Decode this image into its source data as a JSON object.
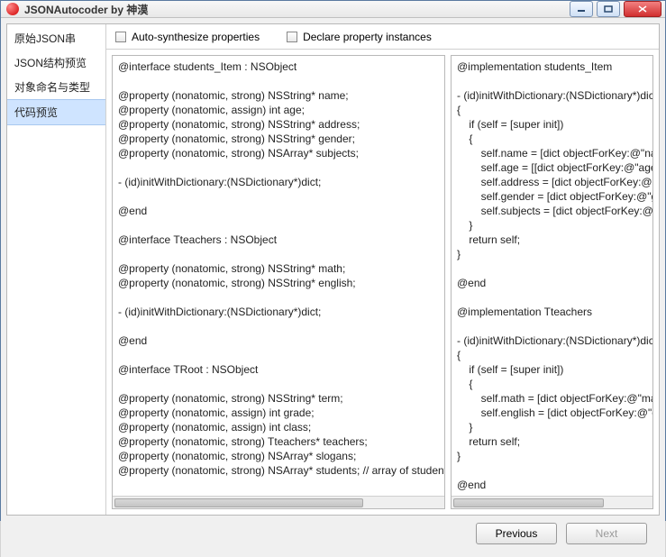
{
  "window": {
    "title": "JSONAutocoder by 神漠"
  },
  "sidebar": {
    "items": [
      {
        "label": "原始JSON串",
        "selected": false
      },
      {
        "label": "JSON结构预览",
        "selected": false
      },
      {
        "label": "对象命名与类型",
        "selected": false
      },
      {
        "label": "代码预览",
        "selected": true
      }
    ]
  },
  "options": {
    "auto_synth": "Auto-synthesize properties",
    "declare_inst": "Declare property instances"
  },
  "code_left": "@interface students_Item : NSObject\n\n@property (nonatomic, strong) NSString* name;\n@property (nonatomic, assign) int age;\n@property (nonatomic, strong) NSString* address;\n@property (nonatomic, strong) NSString* gender;\n@property (nonatomic, strong) NSArray* subjects;\n\n- (id)initWithDictionary:(NSDictionary*)dict;\n\n@end\n\n@interface Tteachers : NSObject\n\n@property (nonatomic, strong) NSString* math;\n@property (nonatomic, strong) NSString* english;\n\n- (id)initWithDictionary:(NSDictionary*)dict;\n\n@end\n\n@interface TRoot : NSObject\n\n@property (nonatomic, strong) NSString* term;\n@property (nonatomic, assign) int grade;\n@property (nonatomic, assign) int class;\n@property (nonatomic, strong) Tteachers* teachers;\n@property (nonatomic, strong) NSArray* slogans;\n@property (nonatomic, strong) NSArray* students; // array of students_Item",
  "code_right": "@implementation students_Item\n\n- (id)initWithDictionary:(NSDictionary*)dict\n{\n    if (self = [super init])\n    {\n        self.name = [dict objectForKey:@\"name\"];\n        self.age = [[dict objectForKey:@\"age\"] intValue];\n        self.address = [dict objectForKey:@\"address\"];\n        self.gender = [dict objectForKey:@\"gender\"];\n        self.subjects = [dict objectForKey:@\"subjects\"];\n    }\n    return self;\n}\n\n@end\n\n@implementation Tteachers\n\n- (id)initWithDictionary:(NSDictionary*)dict\n{\n    if (self = [super init])\n    {\n        self.math = [dict objectForKey:@\"math\"];\n        self.english = [dict objectForKey:@\"english\"];\n    }\n    return self;\n}\n\n@end",
  "footer": {
    "previous": "Previous",
    "next": "Next"
  }
}
